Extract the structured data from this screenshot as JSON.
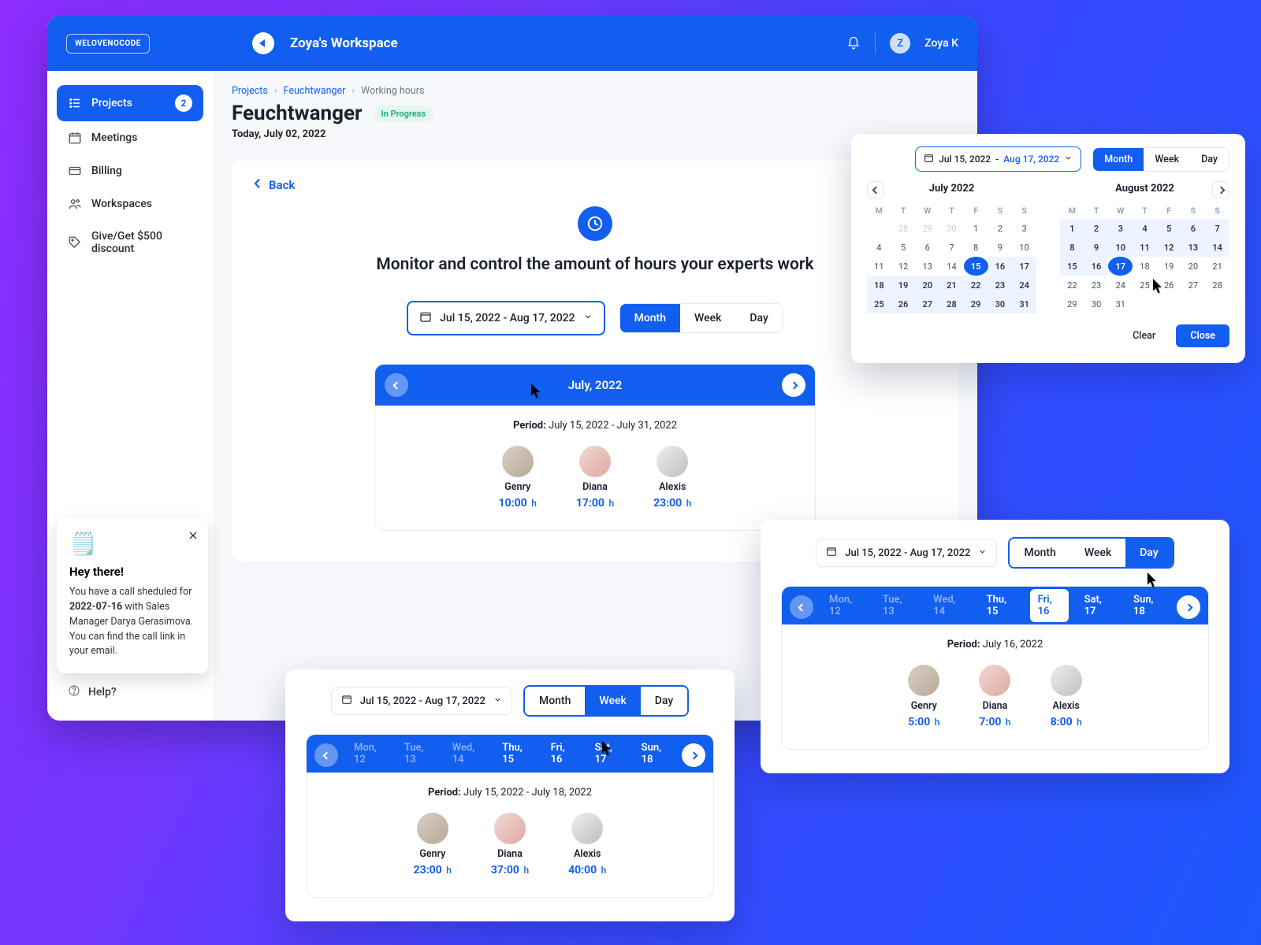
{
  "brand": "WELOVENOCODE",
  "workspace": "Zoya's Workspace",
  "user": {
    "initial": "Z",
    "name": "Zoya K"
  },
  "sidebar": {
    "items": [
      {
        "label": "Projects",
        "badge": "2"
      },
      {
        "label": "Meetings"
      },
      {
        "label": "Billing"
      },
      {
        "label": "Workspaces"
      },
      {
        "label": "Give/Get $500 discount"
      }
    ],
    "help": "Help?"
  },
  "notification": {
    "title": "Hey there!",
    "body_pre": "You have a call sheduled for ",
    "body_bold": "2022-07-16",
    "body_post": " with Sales Manager Darya Gerasimova. You can find the call link in your email."
  },
  "crumbs": {
    "a": "Projects",
    "b": "Feuchtwanger",
    "c": "Working hours"
  },
  "page": {
    "title": "Feuchtwanger",
    "status": "In Progress",
    "today_label": "Today",
    "today_date": ", July 02, 2022",
    "back": "Back",
    "heading": "Monitor and control the amount of hours your experts work"
  },
  "range_label": "Jul 15, 2022 - Aug 17, 2022",
  "seg": {
    "month": "Month",
    "week": "Week",
    "day": "Day"
  },
  "month_view": {
    "title": "July, 2022",
    "period_label": "Period:",
    "period_value": "July 15, 2022 - July 31, 2022",
    "experts": [
      {
        "name": "Genry",
        "hours": "10:00"
      },
      {
        "name": "Diana",
        "hours": "17:00"
      },
      {
        "name": "Alexis",
        "hours": "23:00"
      }
    ]
  },
  "calendar": {
    "range_part1": "Jul 15, 2022",
    "range_dash": "-",
    "range_part2": "Aug 17, 2022",
    "clear": "Clear",
    "close": "Close",
    "left": {
      "title": "July 2022",
      "dow": [
        "M",
        "T",
        "W",
        "T",
        "F",
        "S",
        "S"
      ],
      "rows": [
        [
          "",
          "28",
          "29",
          "30",
          "1",
          "2",
          "3"
        ],
        [
          "4",
          "5",
          "6",
          "7",
          "8",
          "9",
          "10"
        ],
        [
          "11",
          "12",
          "13",
          "14",
          "15",
          "16",
          "17"
        ],
        [
          "18",
          "19",
          "20",
          "21",
          "22",
          "23",
          "24"
        ],
        [
          "25",
          "26",
          "27",
          "28",
          "29",
          "30",
          "31"
        ]
      ]
    },
    "right": {
      "title": "August 2022",
      "dow": [
        "M",
        "T",
        "W",
        "T",
        "F",
        "S",
        "S"
      ],
      "rows": [
        [
          "1",
          "2",
          "3",
          "4",
          "5",
          "6",
          "7"
        ],
        [
          "8",
          "9",
          "10",
          "11",
          "12",
          "13",
          "14"
        ],
        [
          "15",
          "16",
          "17",
          "18",
          "19",
          "20",
          "21"
        ],
        [
          "22",
          "23",
          "24",
          "25",
          "26",
          "27",
          "28"
        ],
        [
          "29",
          "30",
          "31",
          "",
          "",
          "",
          ""
        ]
      ]
    }
  },
  "day_view": {
    "days": [
      "Mon, 12",
      "Tue, 13",
      "Wed, 14",
      "Thu, 15",
      "Fri, 16",
      "Sat, 17",
      "Sun, 18"
    ],
    "period_label": "Period:",
    "period_value": "July 16, 2022",
    "experts": [
      {
        "name": "Genry",
        "hours": "5:00"
      },
      {
        "name": "Diana",
        "hours": "7:00"
      },
      {
        "name": "Alexis",
        "hours": "8:00"
      }
    ]
  },
  "week_view": {
    "days": [
      "Mon, 12",
      "Tue, 13",
      "Wed, 14",
      "Thu, 15",
      "Fri, 16",
      "Sat, 17",
      "Sun, 18"
    ],
    "period_label": "Period:",
    "period_value": "July 15, 2022 - July 18, 2022",
    "experts": [
      {
        "name": "Genry",
        "hours": "23:00"
      },
      {
        "name": "Diana",
        "hours": "37:00"
      },
      {
        "name": "Alexis",
        "hours": "40:00"
      }
    ]
  },
  "h_suffix": "h"
}
